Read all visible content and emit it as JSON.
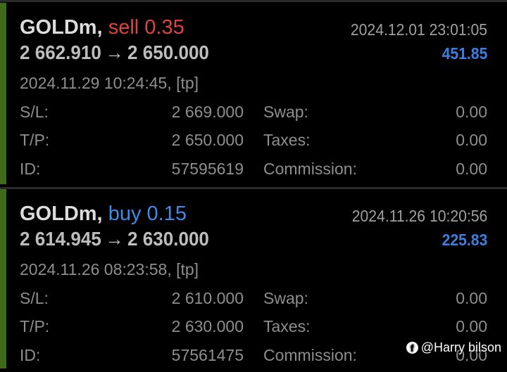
{
  "deals": [
    {
      "symbol": "GOLDm,",
      "side_label": "sell 0.35",
      "close_time": "2024.12.01 23:01:05",
      "price_open": "2 662.910",
      "arrow": "→",
      "price_close": "2 650.000",
      "profit": "451.85",
      "open_time": "2024.11.29 10:24:45, [tp]",
      "sl_label": "S/L:",
      "sl_value": "2 669.000",
      "swap_label": "Swap:",
      "swap_value": "0.00",
      "tp_label": "T/P:",
      "tp_value": "2 650.000",
      "taxes_label": "Taxes:",
      "taxes_value": "0.00",
      "id_label": "ID:",
      "id_value": "57595619",
      "commission_label": "Commission:",
      "commission_value": "0.00"
    },
    {
      "symbol": "GOLDm,",
      "side_label": "buy 0.15",
      "close_time": "2024.11.26 10:20:56",
      "price_open": "2 614.945",
      "arrow": "→",
      "price_close": "2 630.000",
      "profit": "225.83",
      "open_time": "2024.11.26 08:23:58, [tp]",
      "sl_label": "S/L:",
      "sl_value": "2 610.000",
      "swap_label": "Swap:",
      "swap_value": "0.00",
      "tp_label": "T/P:",
      "tp_value": "2 630.000",
      "taxes_label": "Taxes:",
      "taxes_value": "0.00",
      "id_label": "ID:",
      "id_value": "57561475",
      "commission_label": "Commission:",
      "commission_value": "0.00"
    }
  ],
  "watermark": {
    "icon": "facebook-icon",
    "text": "@Harry bilson"
  },
  "colors": {
    "sell": "#e0433b",
    "buy": "#3e8be6",
    "profit": "#3e7fe0",
    "accent": "#3d6b1a"
  }
}
